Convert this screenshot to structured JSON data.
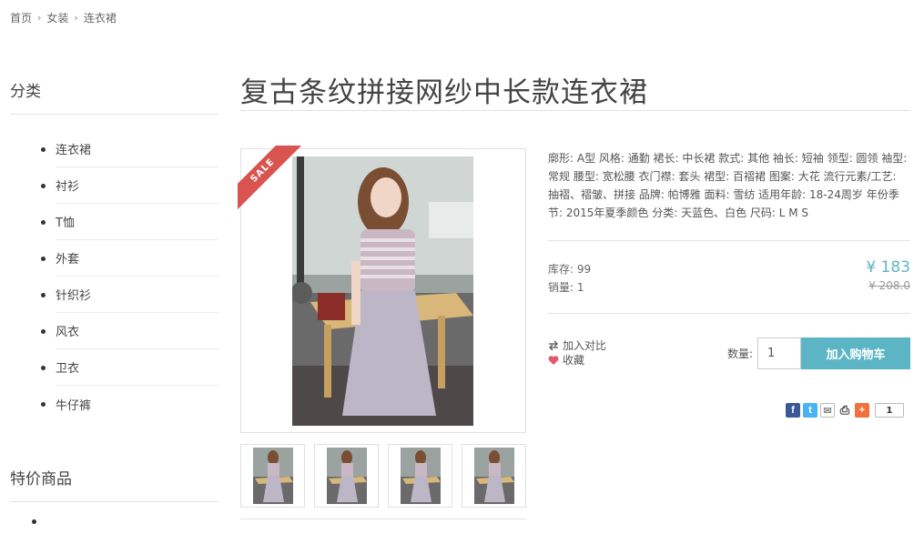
{
  "breadcrumb": [
    "首页",
    "女装",
    "连衣裙"
  ],
  "sidebar": {
    "categories_title": "分类",
    "categories": [
      "连衣裙",
      "衬衫",
      "T恤",
      "外套",
      "针织衫",
      "风衣",
      "卫衣",
      "牛仔裤"
    ],
    "specials_title": "特价商品"
  },
  "product": {
    "title": "复古条纹拼接网纱中长款连衣裙",
    "sale_badge": "SALE",
    "description": "廓形: A型 风格: 通勤 裙长: 中长裙 款式: 其他 袖长: 短袖 领型: 圆领 袖型: 常规 腰型: 宽松腰 衣门襟: 套头 裙型: 百褶裙 图案: 大花 流行元素/工艺: 抽褶、褶皱、拼接 品牌: 帕博雅 面料: 雪纺 适用年龄: 18-24周岁 年份季节: 2015年夏季颜色 分类: 天蓝色、白色 尺码: L M S",
    "stock_label": "库存: 99",
    "sales_label": "销量: 1",
    "price": "¥ 183",
    "old_price": "¥ 208.0",
    "compare_label": "加入对比",
    "favorite_label": "收藏",
    "qty_label": "数量:",
    "qty_value": "1",
    "add_to_cart": "加入购物车",
    "share_count": "1"
  },
  "colors": {
    "accent": "#5bb5c4",
    "sale": "#d9534f",
    "heart": "#e05a6d"
  },
  "icons": [
    "compare-icon",
    "heart-icon",
    "facebook-icon",
    "twitter-icon",
    "email-icon",
    "print-icon",
    "plus-share-icon"
  ]
}
